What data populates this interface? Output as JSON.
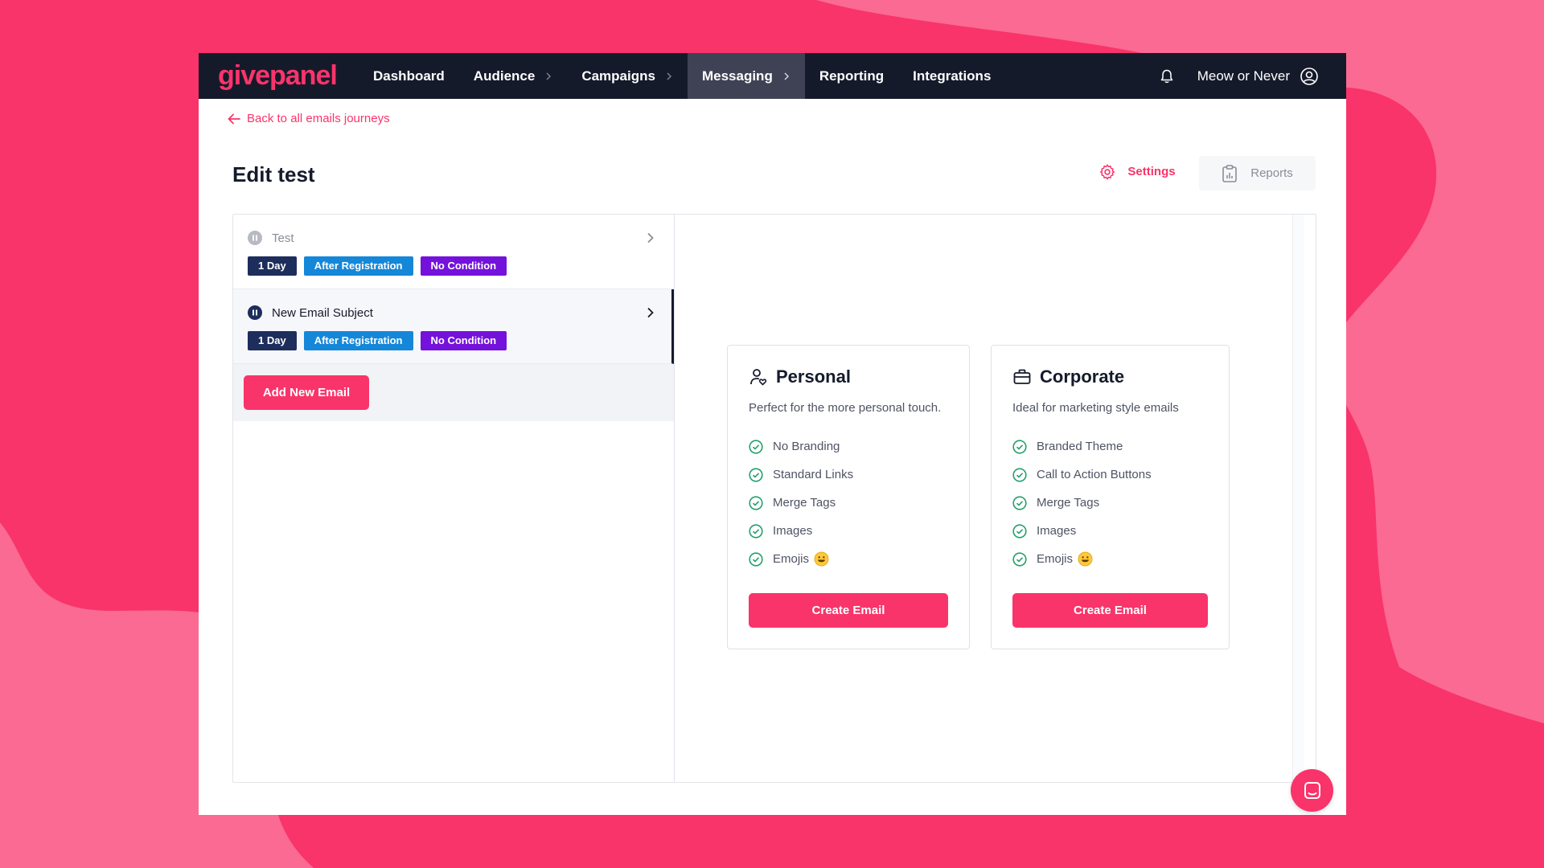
{
  "brand": {
    "logo_text": "givepanel",
    "accent": "#f9346a",
    "nav_bg": "#151a2b"
  },
  "nav": {
    "items": [
      {
        "label": "Dashboard",
        "has_chevron": false,
        "active": false
      },
      {
        "label": "Audience",
        "has_chevron": true,
        "active": false
      },
      {
        "label": "Campaigns",
        "has_chevron": true,
        "active": false
      },
      {
        "label": "Messaging",
        "has_chevron": true,
        "active": true
      },
      {
        "label": "Reporting",
        "has_chevron": false,
        "active": false
      },
      {
        "label": "Integrations",
        "has_chevron": false,
        "active": false
      }
    ],
    "user_name": "Meow or Never",
    "icons": {
      "notifications": "bell-icon",
      "account": "user-circle-icon"
    }
  },
  "back_link": "Back to all emails journeys",
  "page_title": "Edit test",
  "actions": {
    "settings": "Settings",
    "reports": "Reports"
  },
  "emails": [
    {
      "title": "Test",
      "selected": false,
      "tags": {
        "delay": "1 Day",
        "trigger": "After Registration",
        "condition": "No Condition"
      }
    },
    {
      "title": "New Email Subject",
      "selected": true,
      "tags": {
        "delay": "1 Day",
        "trigger": "After Registration",
        "condition": "No Condition"
      }
    }
  ],
  "add_email_label": "Add New Email",
  "templates": {
    "personal": {
      "title": "Personal",
      "description": "Perfect for the more personal touch.",
      "features": [
        "No Branding",
        "Standard Links",
        "Merge Tags",
        "Images",
        "Emojis"
      ],
      "button": "Create Email"
    },
    "corporate": {
      "title": "Corporate",
      "description": "Ideal for marketing style emails",
      "features": [
        "Branded Theme",
        "Call to Action Buttons",
        "Merge Tags",
        "Images",
        "Emojis"
      ],
      "button": "Create Email"
    }
  },
  "tag_colors": {
    "delay": "#1d2d5c",
    "trigger": "#1587d8",
    "condition": "#7412db"
  },
  "check_color": "#22a06b"
}
